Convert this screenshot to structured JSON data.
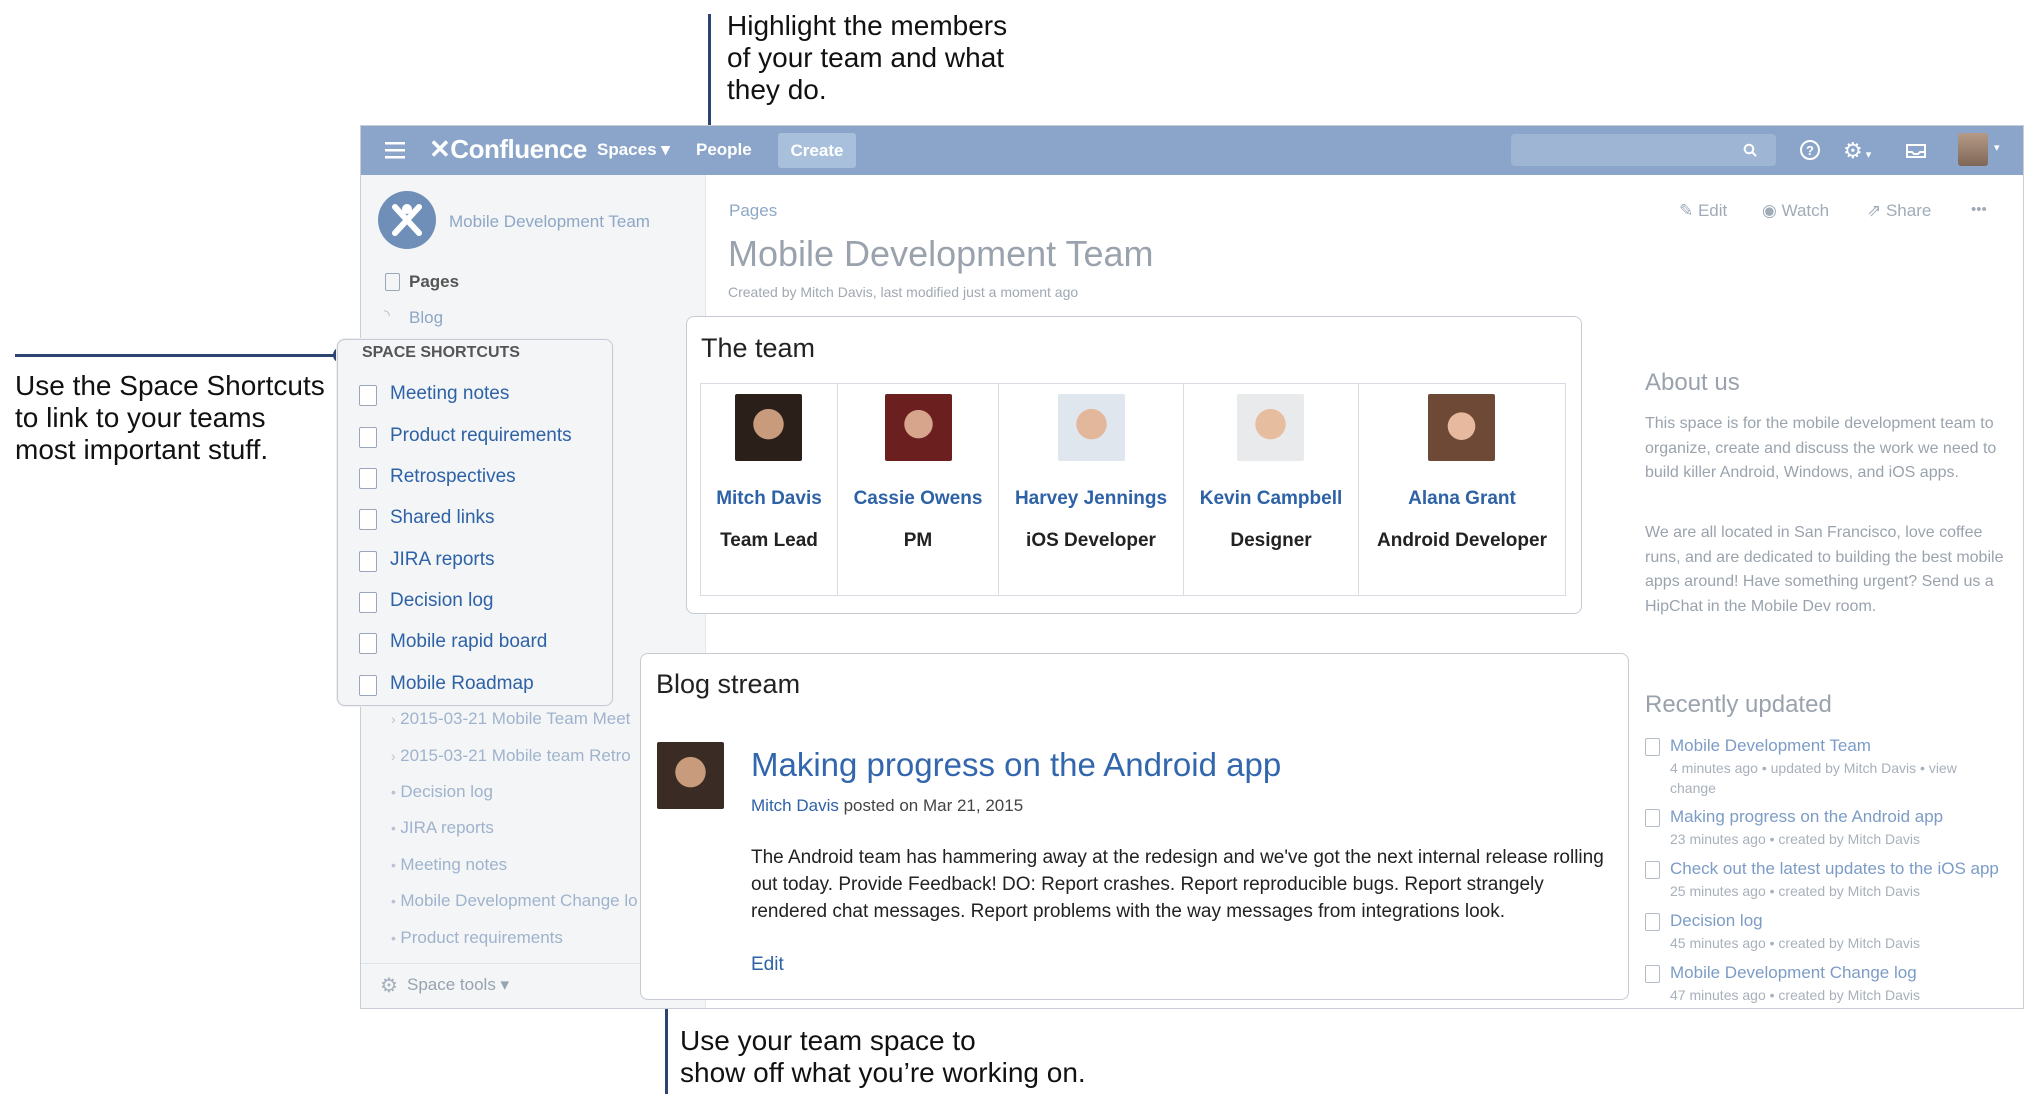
{
  "callouts": {
    "top": [
      "Highlight the members",
      "of your team and what",
      "they do."
    ],
    "left": [
      "Use the Space Shortcuts",
      "to link to your teams",
      "most important stuff."
    ],
    "bottom": [
      "Use your team space to",
      "show off what you’re working on."
    ]
  },
  "topbar": {
    "logo": "Confluence",
    "spaces": "Spaces ▾",
    "people": "People",
    "create": "Create"
  },
  "sidebar": {
    "space_name": "Mobile Development Team",
    "pages": "Pages",
    "blog": "Blog",
    "shortcuts_title": "SPACE SHORTCUTS",
    "shortcuts": [
      "Meeting notes",
      "Product requirements",
      "Retrospectives",
      "Shared links",
      "JIRA reports",
      "Decision log",
      "Mobile rapid board",
      "Mobile Roadmap"
    ],
    "tree": [
      "2015-03-21 Mobile Team Meet",
      "2015-03-21 Mobile team Retro",
      "Decision log",
      "JIRA reports",
      "Meeting notes",
      "Mobile Development Change lo",
      "Product requirements"
    ],
    "space_tools": "Space tools ▾"
  },
  "page": {
    "breadcrumb": "Pages",
    "title": "Mobile Development Team",
    "byline": "Created by Mitch Davis, last modified just a moment ago",
    "actions": {
      "edit": "Edit",
      "watch": "Watch",
      "share": "Share",
      "more": "•••"
    }
  },
  "team": {
    "heading": "The team",
    "members": [
      {
        "name": "Mitch Davis",
        "role": "Team Lead"
      },
      {
        "name": "Cassie Owens",
        "role": "PM"
      },
      {
        "name": "Harvey Jennings",
        "role": "iOS Developer"
      },
      {
        "name": "Kevin Campbell",
        "role": "Designer"
      },
      {
        "name": "Alana Grant",
        "role": "Android Developer"
      }
    ]
  },
  "blog": {
    "heading": "Blog stream",
    "post_title": "Making progress on the Android app",
    "author": "Mitch Davis",
    "posted": " posted on Mar 21, 2015",
    "body": "The Android team has hammering away at the redesign and we've got the next internal release rolling out today. Provide Feedback! DO: Report crashes. Report reproducible bugs. Report strangely rendered chat messages. Report problems with the way messages from integrations look.",
    "edit": "Edit"
  },
  "about": {
    "heading": "About us",
    "p1": "This space is for the mobile development team to organize, create and discuss the work we need to build killer Android, Windows, and iOS apps.",
    "p2": "We are all located in San Francisco, love coffee runs, and are dedicated to building the best mobile apps around! Have something urgent? Send us a HipChat in the Mobile Dev room."
  },
  "recent": {
    "heading": "Recently updated",
    "items": [
      {
        "title": "Mobile Development Team",
        "meta": "4 minutes ago • updated by Mitch Davis • view change"
      },
      {
        "title": "Making progress on the Android app",
        "meta": "23 minutes ago • created by Mitch Davis"
      },
      {
        "title": "Check out the latest updates to the iOS app",
        "meta": "25 minutes ago • created by Mitch Davis"
      },
      {
        "title": "Decision log",
        "meta": "45 minutes ago • created by Mitch Davis"
      },
      {
        "title": "Mobile Development Change log",
        "meta": "47 minutes ago • created by Mitch Davis"
      }
    ]
  }
}
